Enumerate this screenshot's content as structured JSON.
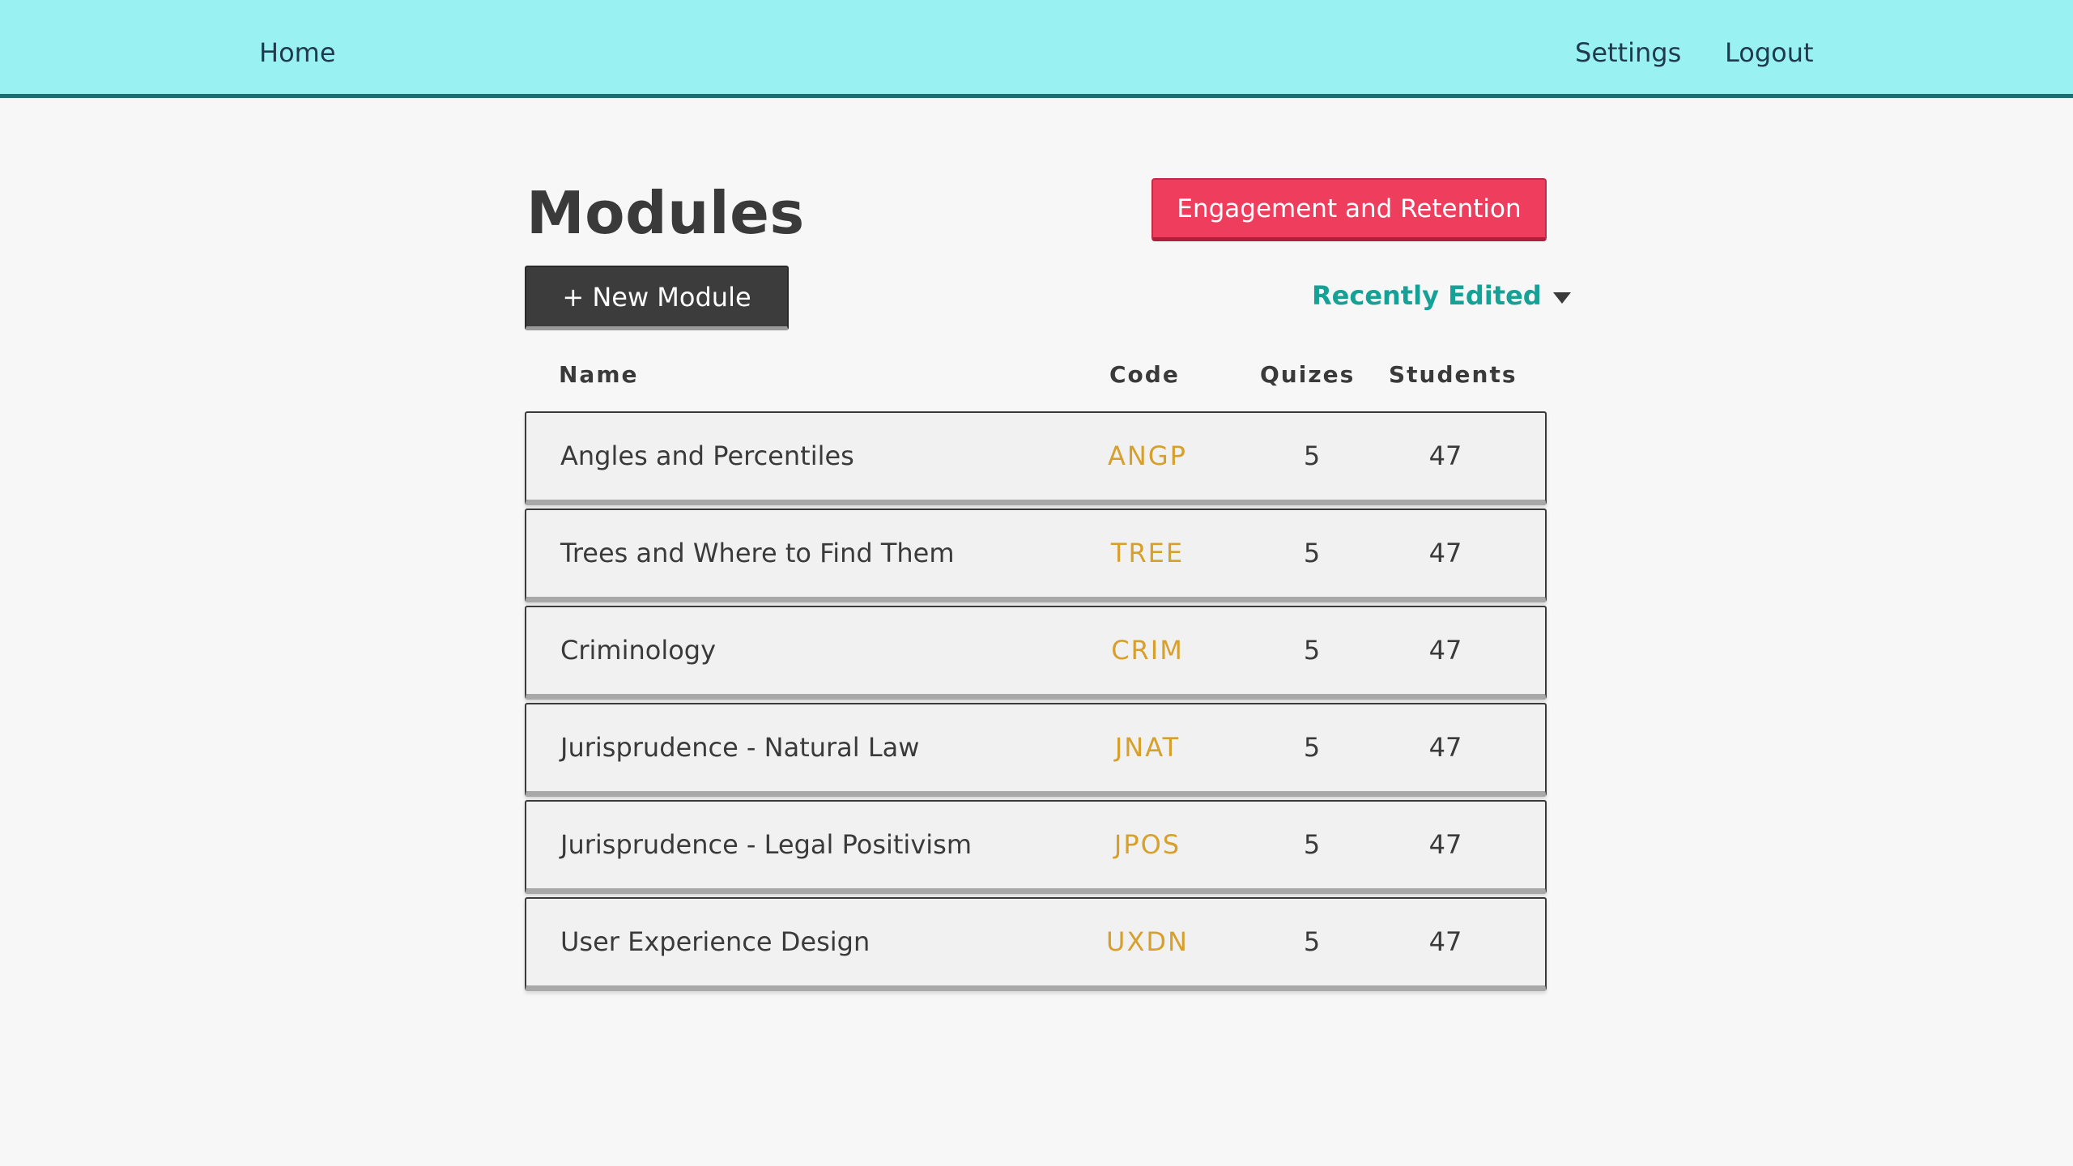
{
  "nav": {
    "home": "Home",
    "settings": "Settings",
    "logout": "Logout"
  },
  "page": {
    "title": "Modules",
    "engagement_button": "Engagement and Retention",
    "new_module_button": "+ New Module",
    "sort_label": "Recently Edited"
  },
  "table": {
    "headers": {
      "name": "Name",
      "code": "Code",
      "quizes": "Quizes",
      "students": "Students"
    },
    "rows": [
      {
        "name": "Angles and Percentiles",
        "code": "ANGP",
        "quizes": "5",
        "students": "47"
      },
      {
        "name": "Trees and Where to Find Them",
        "code": "TREE",
        "quizes": "5",
        "students": "47"
      },
      {
        "name": "Criminology",
        "code": "CRIM",
        "quizes": "5",
        "students": "47"
      },
      {
        "name": "Jurisprudence - Natural Law",
        "code": "JNAT",
        "quizes": "5",
        "students": "47"
      },
      {
        "name": "Jurisprudence - Legal Positivism",
        "code": "JPOS",
        "quizes": "5",
        "students": "47"
      },
      {
        "name": "User Experience Design",
        "code": "UXDN",
        "quizes": "5",
        "students": "47"
      }
    ]
  },
  "colors": {
    "navbar": "#9af1f1",
    "accent_red": "#ef3d5e",
    "teal": "#16a196",
    "code_gold": "#d7a02c"
  },
  "icons": {
    "sort": "caret-down-icon"
  }
}
